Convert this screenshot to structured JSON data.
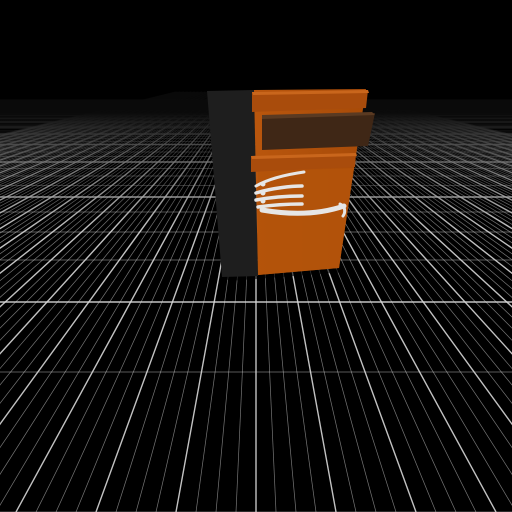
{
  "scene": {
    "background_color": "#000000",
    "grid_line_color": "#d8d8d8",
    "object": {
      "name": "cabinet-with-skeleton-hand",
      "side_panel_color": "#1e1e1e",
      "front_panel_color": "#b0500a",
      "drawer_color": "#a94c0c",
      "open_drawer_color": "#3f2716",
      "hand_color": "#e6e6e6"
    }
  }
}
